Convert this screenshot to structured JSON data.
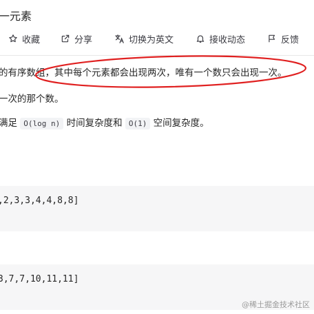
{
  "title": "一元素",
  "toolbar": {
    "items": [
      {
        "label": "收藏",
        "icon": "star-icon"
      },
      {
        "label": "分享",
        "icon": "share-icon"
      },
      {
        "label": "切换为英文",
        "icon": "translate-icon"
      },
      {
        "label": "接收动态",
        "icon": "bell-icon"
      },
      {
        "label": "反馈",
        "icon": "flag-icon"
      }
    ]
  },
  "description": {
    "line1_prefix": "的有序数组，",
    "line1_highlight": "其中每个元素都会出现两次，唯有一个数只会出现一次。",
    "line2": "一次的那个数。",
    "line3_prefix": "满足",
    "line3_code1": "O(log n)",
    "line3_mid": "时间复杂度和",
    "line3_code2": "O(1)",
    "line3_suffix": "空间复杂度。"
  },
  "examples": {
    "example1_input": ",2,3,3,4,4,8,8]",
    "example2_input": "3,7,7,10,11,11]"
  },
  "watermark": {
    "text": "@稀土掘金技术社区"
  },
  "colors": {
    "annotation": "#e02020",
    "code_block_bg": "#f6f6f7"
  }
}
